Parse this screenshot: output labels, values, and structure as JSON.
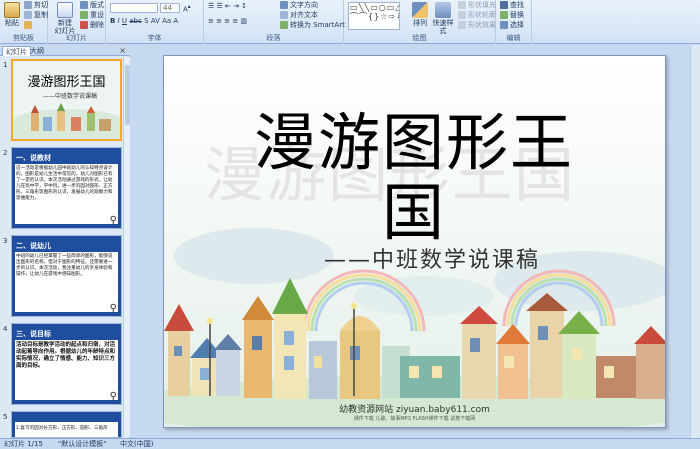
{
  "ribbon": {
    "clipboard": {
      "paste": "粘贴",
      "cut": "剪切",
      "copy": "复制",
      "format_painter": "格式刷",
      "label": "剪贴板"
    },
    "slides": {
      "new_slide": "新建\n幻灯片",
      "layout": "版式",
      "reset": "重设",
      "delete": "删除",
      "label": "幻灯片"
    },
    "font": {
      "font_name": "",
      "font_size": "44",
      "label": "字体"
    },
    "paragraph": {
      "text_direction": "文字方向",
      "align_text": "对齐文本",
      "smartart": "转换为 SmartArt",
      "label": "段落"
    },
    "drawing": {
      "arrange": "排列",
      "quick_styles": "快速样式",
      "shape_fill": "形状填充",
      "shape_outline": "形状轮廓",
      "shape_effects": "形状效果",
      "label": "绘图",
      "shapes": "▭╲╲▭○▭△⌐\n⌒⌒{}☆⇨⇩◇"
    },
    "editing": {
      "find": "查找",
      "replace": "替换",
      "select": "选择",
      "label": "编辑"
    }
  },
  "leftpane": {
    "tab_slides": "幻灯片",
    "tab_outline": "大纲",
    "thumbs": [
      {
        "num": "1",
        "title": "漫游图形王国",
        "subtitle": "——中班数学说课稿"
      },
      {
        "num": "2",
        "title": "一、说教材",
        "body": "这一活动是根据幼儿园中班幼儿的认知特点设计的。图形是幼儿生活中常见的，幼儿对图形已有了一定的认识。本次活动通过游戏的形式，让幼儿在玩中学，学中玩，进一步巩固对圆形、正方形、三角形等图形的认识，发展幼儿的观察力和思维能力。"
      },
      {
        "num": "3",
        "title": "二、说幼儿",
        "body": "中班的幼儿已经掌握了一些简单的图形，能够说出图形的名称。但对于图形的特征，还需要进一步的认识。本次活动，我注重幼儿的亲身体验和操作，让幼儿在游戏中感知图形。"
      },
      {
        "num": "4",
        "title": "三、说目标",
        "body": "活动目标是教学活动的起点和归宿，对活动起着导向作用。根据幼儿的年龄特点和实际情况，确立了情感、能力、知识三方面的目标。"
      },
      {
        "num": "5",
        "title": "",
        "body": "1.复习巩固对长方形、正方形、圆形、三角形"
      }
    ]
  },
  "slide": {
    "title": "漫游图形王国",
    "subtitle": "——中班数学说课稿",
    "site": "幼教资源网站  ziyuan.baby611.com",
    "links": "课件下载    儿歌、故事MP3    FLASH课件下载    试卷下载网"
  },
  "status": {
    "slide_pos": "幻灯片 1/15",
    "theme": "\"默认设计模板\"",
    "lang": "中文(中国)"
  },
  "colors": {
    "ribbon": "#dce8f6",
    "slide_border": "#7d97bd",
    "thumb_bg": "#1f4e9e",
    "selected": "#f0a830"
  }
}
